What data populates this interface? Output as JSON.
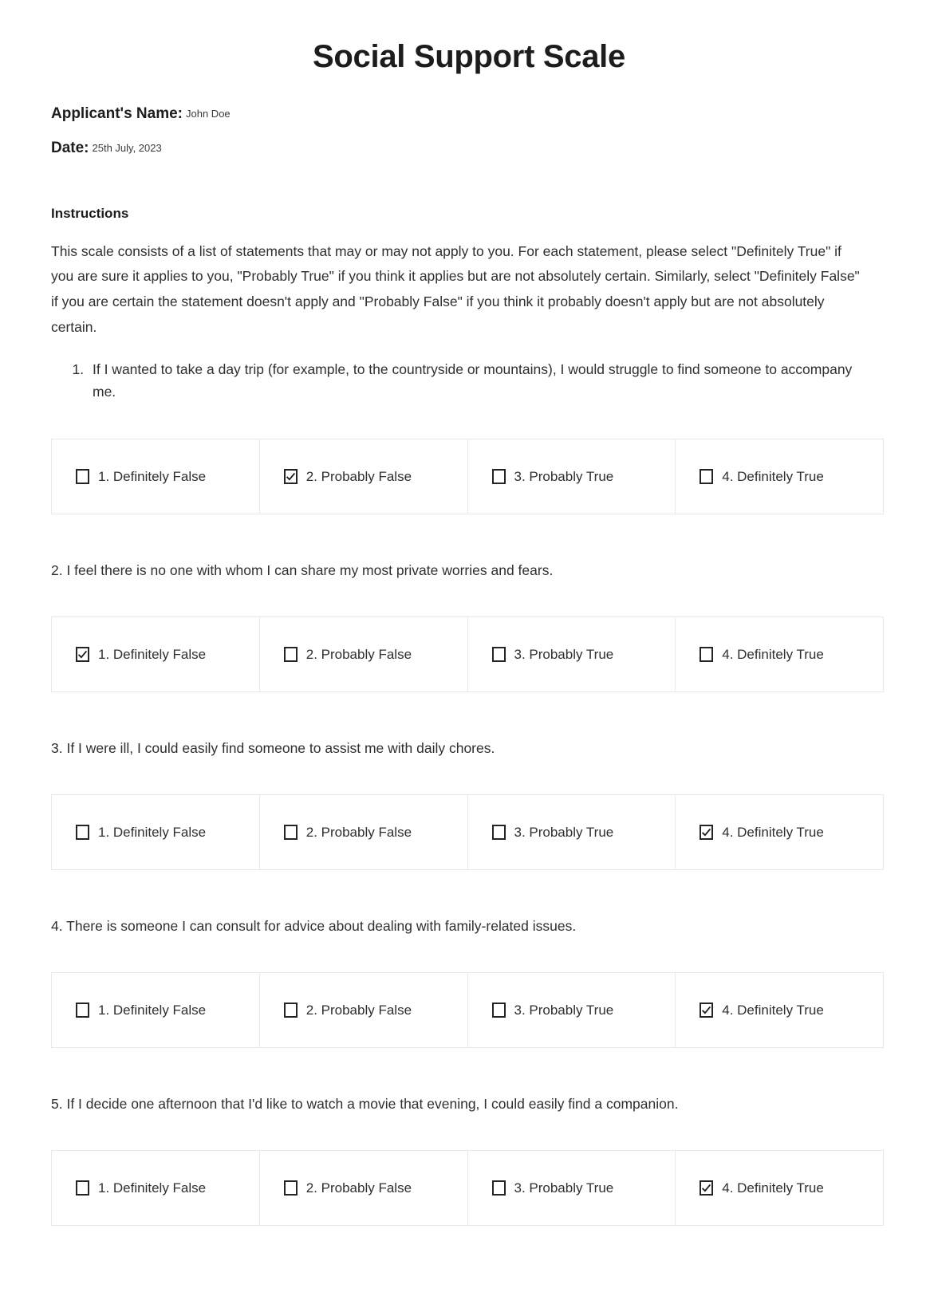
{
  "document": {
    "title": "Social Support Scale",
    "fields": [
      {
        "label": "Applicant's Name:",
        "value": "John Doe"
      },
      {
        "label": "Date:",
        "value": "25th July, 2023"
      }
    ],
    "instructions_heading": "Instructions",
    "instructions_text": "This scale consists of a list of statements that may or may not apply to you. For each statement, please select \"Definitely True\" if you are sure it applies to you, \"Probably True\" if you think it applies but are not absolutely certain. Similarly, select \"Definitely False\" if you are certain the statement doesn't apply and \"Probably False\" if you think it probably doesn't apply but are not absolutely",
    "instructions_text_last_line": "certain."
  },
  "scale_options": [
    "1. Definitely False",
    "2. Probably False",
    "3. Probably True",
    "4. Definitely True"
  ],
  "questions": [
    {
      "number": "1.",
      "text": "If I wanted to take a day trip (for example, to the countryside or mountains), I would struggle to find someone to accompany me.",
      "full_text": "1. If I wanted to take a day trip (for example, to the countryside or mountains), I would struggle to find someone to accompany me.",
      "selected_index": 1,
      "selected_label": "2. Probably False"
    },
    {
      "number": "2.",
      "text": "I feel there is no one with whom I can share my most private worries and fears.",
      "full_text": "2. I feel there is no one with whom I can share my most private worries and fears.",
      "selected_index": 0,
      "selected_label": "1. Definitely False"
    },
    {
      "number": "3.",
      "text": "If I were ill, I could easily find someone to assist me with daily chores.",
      "full_text": "3. If I were ill, I could easily find someone to assist me with daily chores.",
      "selected_index": 3,
      "selected_label": "4. Definitely True"
    },
    {
      "number": "4.",
      "text": "There is someone I can consult for advice about dealing with family-related issues.",
      "full_text": "4. There is someone I can consult for advice about dealing with family-related issues.",
      "selected_index": 3,
      "selected_label": "4. Definitely True"
    },
    {
      "number": "5.",
      "text": "If I decide one afternoon that I'd like to watch a movie that evening, I could easily find a companion.",
      "full_text": "5. If I decide one afternoon that I'd like to watch a movie that evening, I could easily find a companion.",
      "selected_index": 3,
      "selected_label": "4. Definitely True"
    }
  ],
  "colors": {
    "text": "#2f2f2f",
    "heading": "#1c1c1c",
    "table_border": "#e9e9e9",
    "checkbox_border": "#242424",
    "page_background": "#ffffff"
  }
}
